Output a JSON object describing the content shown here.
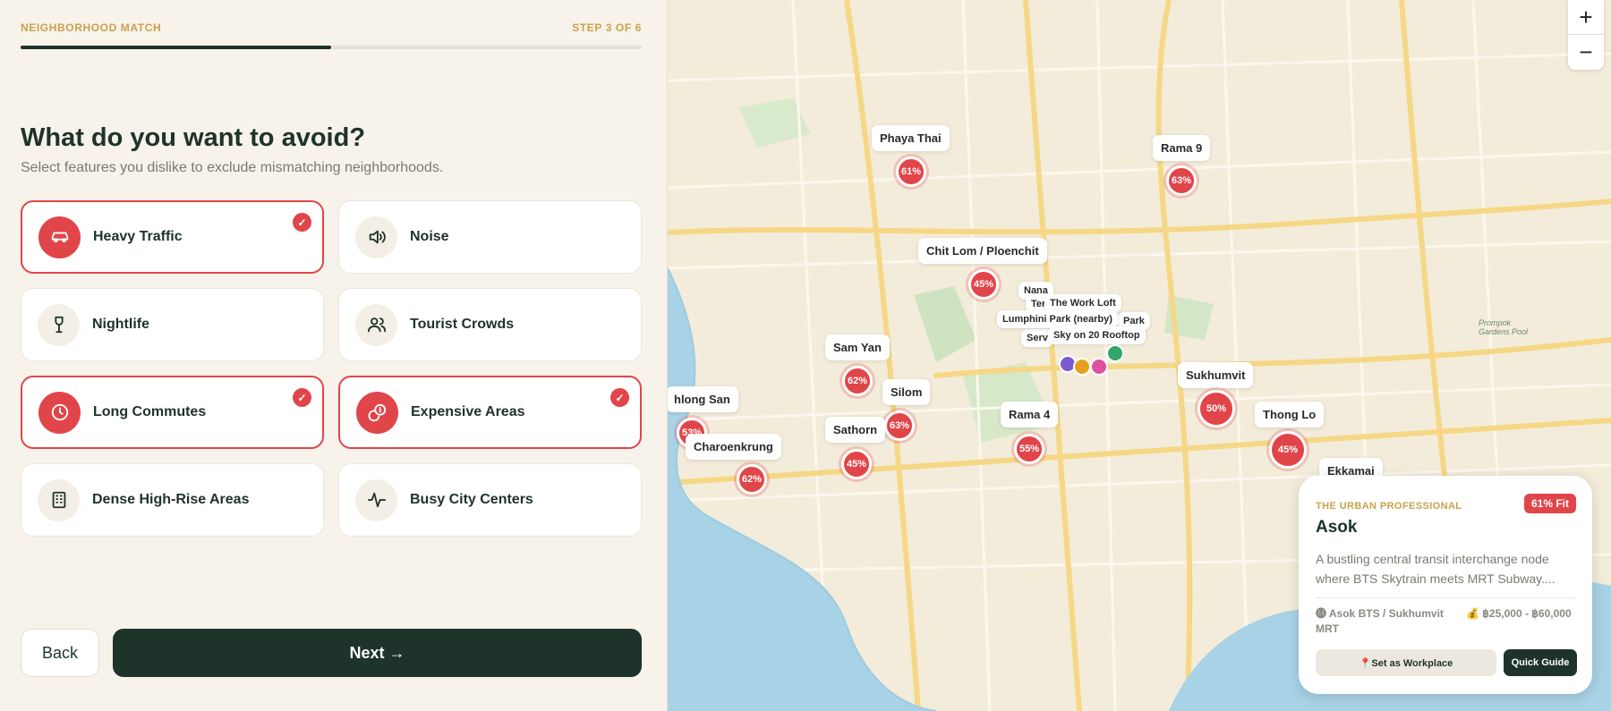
{
  "header": {
    "step_label": "NEIGHBORHOOD MATCH",
    "step_count": "STEP 3 OF 6",
    "progress": 0.5
  },
  "question": {
    "title": "What do you want to avoid?",
    "subtitle": "Select features you dislike to exclude mismatching neighborhoods."
  },
  "options": [
    {
      "label": "Heavy Traffic",
      "icon": "car-icon",
      "selected": true
    },
    {
      "label": "Noise",
      "icon": "speaker-icon",
      "selected": false
    },
    {
      "label": "Nightlife",
      "icon": "cocktail-icon",
      "selected": false
    },
    {
      "label": "Tourist Crowds",
      "icon": "users-icon",
      "selected": false
    },
    {
      "label": "Long Commutes",
      "icon": "clock-icon",
      "selected": true
    },
    {
      "label": "Expensive Areas",
      "icon": "coins-icon",
      "selected": true
    },
    {
      "label": "Dense High-Rise Areas",
      "icon": "building-icon",
      "selected": false
    },
    {
      "label": "Busy City Centers",
      "icon": "activity-icon",
      "selected": false
    }
  ],
  "check_glyph": "✓",
  "footer": {
    "back_label": "Back",
    "next_label": "Next →"
  },
  "map": {
    "zoom_in": "+",
    "zoom_out": "−",
    "areas": [
      {
        "name": "Phaya Thai",
        "fit": "61%"
      },
      {
        "name": "Rama 9",
        "fit": "63%"
      },
      {
        "name": "Chit Lom / Ploenchit",
        "fit": "45%"
      },
      {
        "name": "Sam Yan",
        "fit": "62%"
      },
      {
        "name": "Silom",
        "fit": "63%"
      },
      {
        "name": "Sathorn",
        "fit": "45%"
      },
      {
        "name": "Rama 4",
        "fit": "55%"
      },
      {
        "name": "Sukhumvit",
        "fit": "50%"
      },
      {
        "name": "Thong Lo",
        "fit": "45%"
      },
      {
        "name": "hlong San",
        "fit": "53%"
      },
      {
        "name": "Charoenkrung",
        "fit": "62%"
      },
      {
        "name": "Ekkamai",
        "fit": ""
      }
    ],
    "poi_labels": [
      "Nana",
      "Ter",
      "The Work Loft",
      "Lumphini Park (nearby)",
      "Park",
      "Sky on 20 Rooftop",
      "Serv"
    ],
    "map_labels": [
      "Prompok Gardens Pool"
    ]
  },
  "info_card": {
    "persona": "THE URBAN PROFESSIONAL",
    "fit_badge": "61% Fit",
    "name": "Asok",
    "description": "A bustling central transit interchange node where BTS Skytrain meets MRT Subway....",
    "transit": "🅜 Asok BTS / Sukhumvit MRT",
    "price": "💰 ฿25,000 - ฿60,000",
    "workplace_label": "📍Set as Workplace",
    "guide_label": "Quick Guide"
  },
  "colors": {
    "accent": "#e0454a",
    "primary": "#1e3329",
    "gold": "#c9a24c",
    "background": "#f7f2ea"
  }
}
